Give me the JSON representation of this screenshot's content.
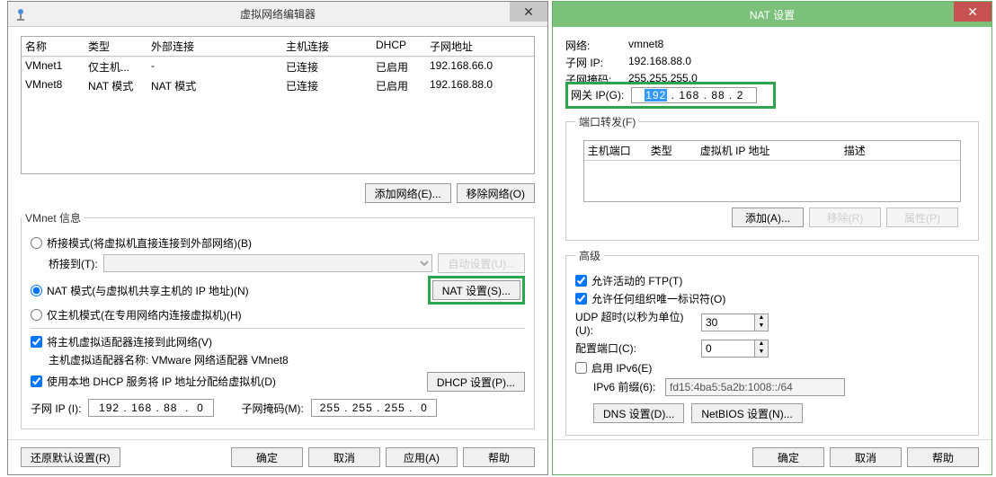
{
  "editor": {
    "title": "虚拟网络编辑器",
    "cols": {
      "name": "名称",
      "type": "类型",
      "ext": "外部连接",
      "host": "主机连接",
      "dhcp": "DHCP",
      "subnet": "子网地址"
    },
    "rows": [
      {
        "name": "VMnet1",
        "type": "仅主机...",
        "ext": "-",
        "host": "已连接",
        "dhcp": "已启用",
        "subnet": "192.168.66.0"
      },
      {
        "name": "VMnet8",
        "type": "NAT 模式",
        "ext": "NAT 模式",
        "host": "已连接",
        "dhcp": "已启用",
        "subnet": "192.168.88.0"
      }
    ],
    "add_net": "添加网络(E)...",
    "remove_net": "移除网络(O)",
    "vmnet_info": "VMnet 信息",
    "bridge": "桥接模式(将虚拟机直接连接到外部网络)(B)",
    "bridge_to": "桥接到(T):",
    "auto_set": "自动设置(U)...",
    "nat": "NAT 模式(与虚拟机共享主机的 IP 地址)(N)",
    "nat_settings": "NAT 设置(S)...",
    "hostonly": "仅主机模式(在专用网络内连接虚拟机)(H)",
    "connect_host": "将主机虚拟适配器连接到此网络(V)",
    "adapter_name": "主机虚拟适配器名称: VMware 网络适配器 VMnet8",
    "use_dhcp": "使用本地 DHCP 服务将 IP 地址分配给虚拟机(D)",
    "dhcp_settings": "DHCP 设置(P)...",
    "subnet_ip_label": "子网 IP (I):",
    "subnet_ip": "192 . 168 . 88  .  0",
    "mask_label": "子网掩码(M):",
    "mask": "255 . 255 . 255 .  0",
    "restore": "还原默认设置(R)",
    "ok": "确定",
    "cancel": "取消",
    "apply": "应用(A)",
    "help": "帮助"
  },
  "nat": {
    "title": "NAT 设置",
    "network_label": "网络:",
    "network": "vmnet8",
    "subnet_ip_label": "子网 IP:",
    "subnet_ip": "192.168.88.0",
    "mask_label": "子网掩码:",
    "mask": "255.255.255.0",
    "gateway_label": "网关 IP(G):",
    "gateway_a": "192",
    "gateway_rest": " . 168 . 88  .  2",
    "port_fwd": "端口转发(F)",
    "pf_cols": {
      "host_port": "主机端口",
      "type": "类型",
      "vm_ip": "虚拟机 IP 地址",
      "desc": "描述"
    },
    "add": "添加(A)...",
    "remove": "移除(R)",
    "props": "属性(P)",
    "advanced": "高级",
    "allow_ftp": "允许活动的 FTP(T)",
    "allow_any_org": "允许任何组织唯一标识符(O)",
    "udp_timeout_label": "UDP 超时(以秒为单位)(U):",
    "udp_timeout": "30",
    "config_port_label": "配置端口(C):",
    "config_port": "0",
    "enable_ipv6": "启用 IPv6(E)",
    "ipv6_prefix_label": "IPv6 前缀(6):",
    "ipv6_prefix": "fd15:4ba5:5a2b:1008::/64",
    "dns_settings": "DNS 设置(D)...",
    "netbios_settings": "NetBIOS 设置(N)...",
    "ok": "确定",
    "cancel": "取消",
    "help": "帮助"
  }
}
